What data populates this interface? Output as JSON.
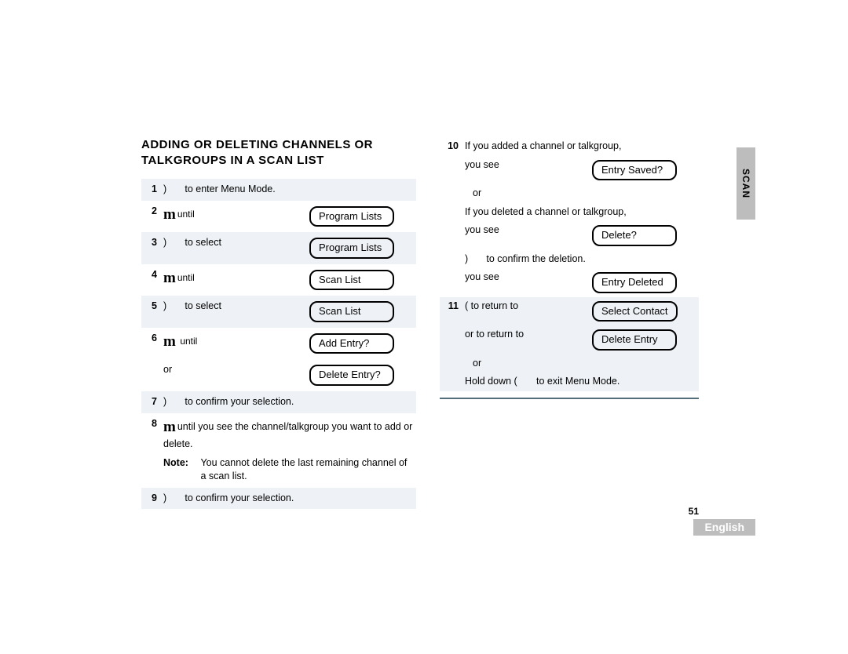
{
  "heading": "ADDING OR DELETING CHANNELS OR TALKGROUPS IN A SCAN LIST",
  "sideTab": "SCAN",
  "pageNumber": "51",
  "language": "English",
  "left": {
    "step1": {
      "num": "1",
      "text": "to enter Menu Mode.",
      "paren": ")"
    },
    "step2": {
      "num": "2",
      "m": "m",
      "until": "until",
      "pill": "Program Lists"
    },
    "step3": {
      "num": "3",
      "paren": ")",
      "text": "to select",
      "pill": "Program Lists"
    },
    "step4": {
      "num": "4",
      "m": "m",
      "until": "until",
      "pill": "Scan List"
    },
    "step5": {
      "num": "5",
      "paren": ")",
      "text": "to select",
      "pill": "Scan List"
    },
    "step6": {
      "num": "6",
      "m": "m",
      "until": "until",
      "pillA": "Add Entry?",
      "or": "or",
      "pillB": "Delete Entry?"
    },
    "step7": {
      "num": "7",
      "paren": ")",
      "text": "to confirm your selection."
    },
    "step8": {
      "num": "8",
      "m": "m",
      "text": "until you see the channel/talkgroup you want to add or delete.",
      "noteLabel": "Note:",
      "noteText": "You cannot delete the last remaining channel of a scan list."
    },
    "step9": {
      "num": "9",
      "paren": ")",
      "text": "to confirm your selection."
    }
  },
  "right": {
    "step10": {
      "num": "10",
      "line1": "If you added a channel or talkgroup,",
      "youSee": "you see",
      "pillSaved": "Entry Saved?",
      "or": "or",
      "line2": "If you deleted a channel or talkgroup,",
      "pillDelete": "Delete?",
      "confirmParen": ")",
      "confirmText": "to confirm the deletion.",
      "pillDeleted": "Entry Deleted"
    },
    "step11": {
      "num": "11",
      "returnParen": "(",
      "returnText": "to return to",
      "pillSelect": "Select Contact",
      "orReturn": "or to return to",
      "pillDeleteEntry": "Delete Entry",
      "or": "or",
      "holdA": "Hold down (",
      "holdB": "to exit Menu Mode."
    }
  }
}
